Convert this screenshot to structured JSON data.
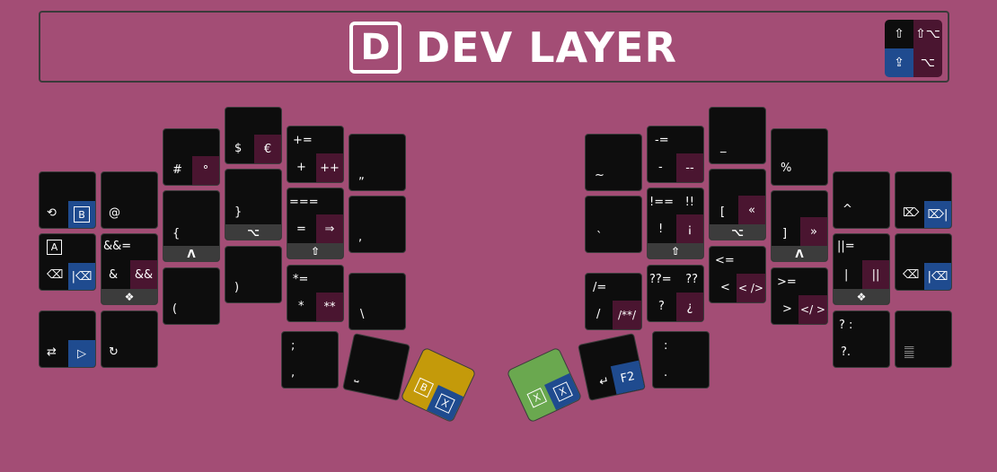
{
  "header": {
    "logo_letter": "D",
    "title": "DEV LAYER",
    "modifiers": {
      "shift": "⇧",
      "shift_alt": "⇧⌥",
      "caps_lock": "⇪",
      "alt": "⌥"
    }
  },
  "colors": {
    "background": "#a34d75",
    "key": "#0d0d0d",
    "accent_plum": "#4a1530",
    "accent_blue": "#1f4b8f",
    "bar": "#3c3c3c",
    "thumb_gold": "#c49a0a",
    "thumb_green": "#6aa84f"
  },
  "keys": {
    "undo": {
      "label": "⟲",
      "sub": "B"
    },
    "hold_a": {
      "label": "⌫",
      "sub": "|⌫",
      "box": "A"
    },
    "tab_play": {
      "label": "⇄",
      "sub": "▷"
    },
    "at": {
      "label": "@"
    },
    "amp": {
      "top": "&&=",
      "label": "&",
      "sub": "&&",
      "bar": "❖"
    },
    "redo": {
      "label": "↻"
    },
    "hash": {
      "label": "#",
      "sub": "°"
    },
    "brace_open": {
      "label": "{",
      "bar": "Λ"
    },
    "paren_open": {
      "label": "("
    },
    "dollar": {
      "label": "$",
      "sub": "€"
    },
    "brace_close": {
      "label": "}",
      "bar": "⌥"
    },
    "paren_close": {
      "label": ")"
    },
    "plus": {
      "top": "+=",
      "label": "+",
      "sub": "++"
    },
    "equals": {
      "top": "===",
      "label": "=",
      "sub": "⇒",
      "bar": "⇧"
    },
    "star": {
      "top": "*=",
      "label": "*",
      "sub": "**"
    },
    "dquote": {
      "label": "„"
    },
    "comma": {
      "label": ","
    },
    "backslash": {
      "label": "\\"
    },
    "semicolon": {
      "top": ";",
      "label": ","
    },
    "space": {
      "label": "⎵"
    },
    "tilde": {
      "label": "~"
    },
    "backtick": {
      "label": "`"
    },
    "slash": {
      "top": "/=",
      "label": "/",
      "sub": "/**/"
    },
    "minus": {
      "top": "-=",
      "label": "-",
      "sub": "--"
    },
    "bang": {
      "top": "!==",
      "top2": "!!",
      "label": "!",
      "sub": "¡",
      "bar": "⇧"
    },
    "question": {
      "top": "??=",
      "top2": "??",
      "label": "?",
      "sub": "¿"
    },
    "underscore": {
      "label": "_"
    },
    "bracket_open": {
      "label": "[",
      "sub": "«",
      "bar": "⌥"
    },
    "less": {
      "top": "<=",
      "label": "<",
      "sub": "< />"
    },
    "percent": {
      "label": "%"
    },
    "bracket_close": {
      "label": "]",
      "sub": "»",
      "bar": "Λ"
    },
    "greater": {
      "top": ">=",
      "label": ">",
      "sub": "</ >"
    },
    "caret": {
      "label": "^"
    },
    "pipe": {
      "top": "||=",
      "label": "|",
      "sub": "||",
      "bar": "❖"
    },
    "ternary": {
      "top": "? :",
      "label": "?."
    },
    "del_word": {
      "label": "⌦",
      "sub": "⌦|"
    },
    "backspace": {
      "label": "⌫",
      "sub": "|⌫"
    },
    "numpad": {
      "label": "𝄛"
    },
    "colon": {
      "top": ":",
      "label": "."
    },
    "enter": {
      "label": "↵",
      "sub": "F2"
    },
    "thumb_left": {
      "a": "B",
      "b": "X"
    },
    "thumb_right": {
      "a": "X",
      "b": "X"
    }
  }
}
